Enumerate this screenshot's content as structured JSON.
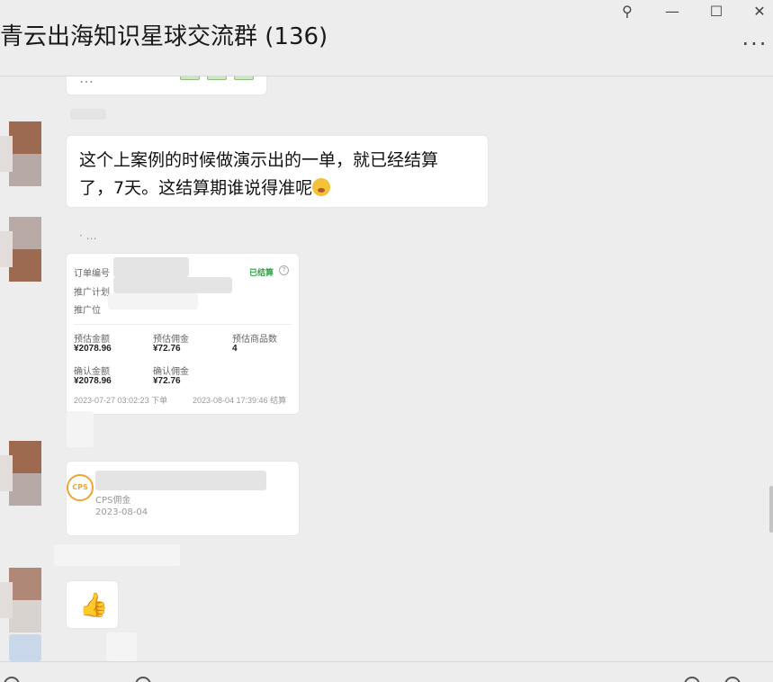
{
  "window": {
    "title": "青云出海知识星球交流群 (136)",
    "pin_icon": "⚲",
    "minimize_icon": "—",
    "maximize_icon": "☐",
    "close_icon": "✕",
    "more_icon": "···"
  },
  "messages": {
    "top_partial": "…",
    "text_message": {
      "line1": "这个上案例的时候做演示出的一单，就已经结算",
      "line2": "了，7天。这结算期谁说得准呢"
    },
    "ellipsis": "· …",
    "order_card": {
      "label_order_no": "订单编号",
      "label_plan": "推广计划",
      "label_position": "推广位",
      "status": "已结算",
      "help_icon": "?",
      "label_est_amount": "预估金额",
      "label_est_commission": "预估佣金",
      "label_est_items": "预估商品数",
      "est_amount": "¥2078.96",
      "est_commission": "¥72.76",
      "est_items": "4",
      "label_confirm_amount": "确认金额",
      "label_confirm_commission": "确认佣金",
      "confirm_amount": "¥2078.96",
      "confirm_commission": "¥72.76",
      "order_time": "2023-07-27 03:02:23 下单",
      "settle_time": "2023-08-04 17:39:46 结算"
    },
    "cps_card": {
      "logo": "CPS",
      "label": "CPS佣金",
      "date": "2023-08-04"
    },
    "thumbs_up": "👍"
  }
}
